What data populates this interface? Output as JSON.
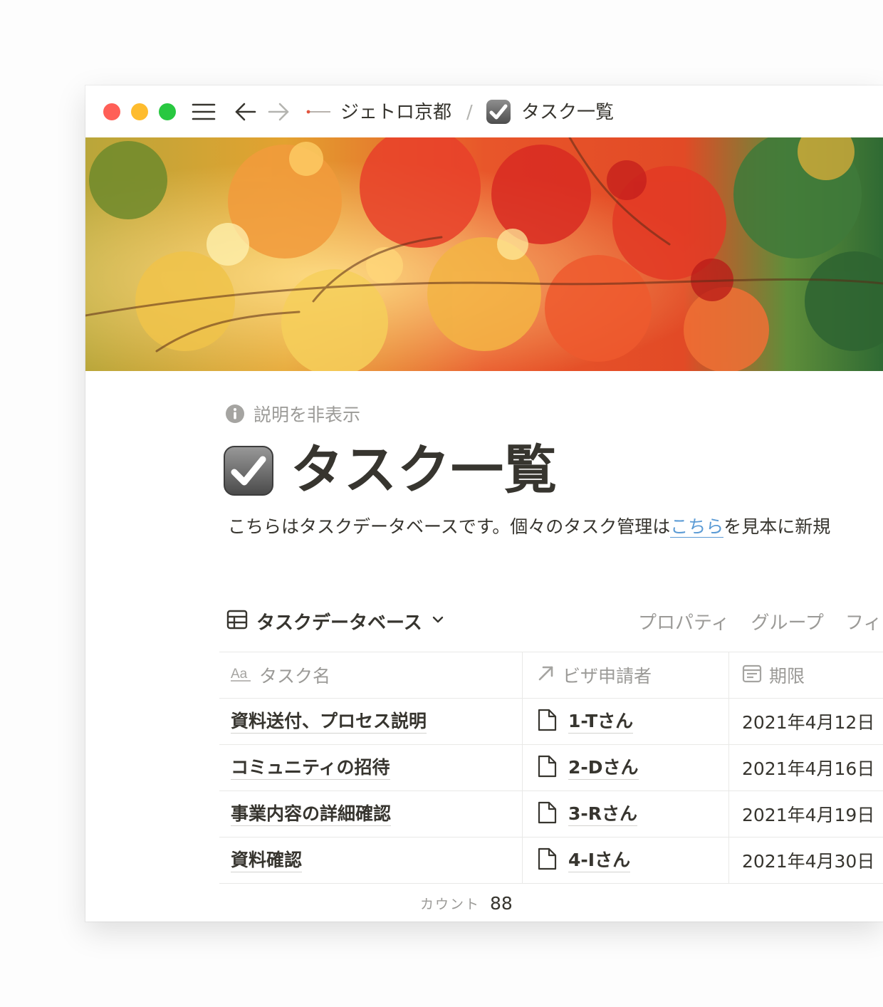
{
  "window": {
    "breadcrumb": {
      "workspace": "ジェトロ京都",
      "separator": "/",
      "page": "タスク一覧"
    }
  },
  "page": {
    "hide_description": "説明を非表示",
    "title": "タスク一覧",
    "description_before": "こちらはタスクデータベースです。個々のタスク管理は",
    "description_link": "こちら",
    "description_after": "を見本に新規"
  },
  "database": {
    "view_name": "タスクデータベース",
    "options": [
      "プロパティ",
      "グループ",
      "フィ"
    ],
    "columns": [
      {
        "icon": "text-property-icon",
        "label": "タスク名"
      },
      {
        "icon": "relation-arrow-icon",
        "label": "ビザ申請者"
      },
      {
        "icon": "calendar-icon",
        "label": "期限"
      }
    ],
    "rows": [
      {
        "task": "資料送付、プロセス説明",
        "applicant": "1-Tさん",
        "due": "2021年4月12日"
      },
      {
        "task": "コミュニティの招待",
        "applicant": "2-Dさん",
        "due": "2021年4月16日"
      },
      {
        "task": "事業内容の詳細確認",
        "applicant": "3-Rさん",
        "due": "2021年4月19日"
      },
      {
        "task": "資料確認",
        "applicant": "4-Iさん",
        "due": "2021年4月30日"
      }
    ],
    "count_label": "カウント",
    "count_value": "88"
  },
  "colors": {
    "close": "#ff5f57",
    "minimize": "#febc2e",
    "maximize": "#28c840",
    "link": "#5b9bd5",
    "text": "#37352f",
    "muted": "#9b9a97"
  }
}
